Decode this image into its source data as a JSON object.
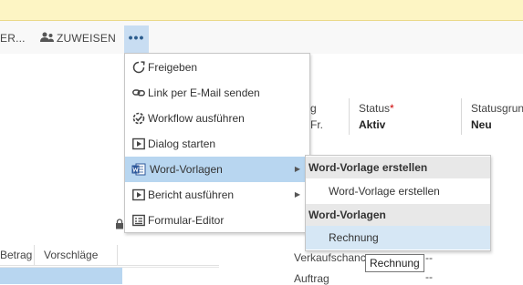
{
  "commandbar": {
    "truncated_item": "ER...",
    "assign_label": "ZUWEISEN",
    "more_label": "•••"
  },
  "header_fields": {
    "partial_label_g": "g",
    "partial_value_fr": "Fr.",
    "status_label": "Status",
    "status_required": "*",
    "status_value": "Aktiv",
    "statusgrund_label": "Statusgrun",
    "statusgrund_value": "Neu"
  },
  "grid": {
    "columns": [
      "Betrag",
      "Vorschläge"
    ]
  },
  "form_fields": {
    "verkaufschance_label": "Verkaufschanc",
    "verkaufschance_value": "--",
    "auftrag_label": "Auftrag",
    "auftrag_value": "--"
  },
  "menu": {
    "items": [
      {
        "label": "Freigeben",
        "icon": "share-icon"
      },
      {
        "label": "Link per E-Mail senden",
        "icon": "link-icon"
      },
      {
        "label": "Workflow ausführen",
        "icon": "workflow-icon"
      },
      {
        "label": "Dialog starten",
        "icon": "dialog-icon"
      },
      {
        "label": "Word-Vorlagen",
        "icon": "word-icon",
        "has_submenu": true,
        "active": true
      },
      {
        "label": "Bericht ausführen",
        "icon": "report-icon",
        "has_submenu": true
      },
      {
        "label": "Formular-Editor",
        "icon": "form-editor-icon"
      }
    ]
  },
  "submenu": {
    "section1_header": "Word-Vorlage erstellen",
    "section1_item": "Word-Vorlage erstellen",
    "section2_header": "Word-Vorlagen",
    "section2_item": "Rechnung"
  },
  "tooltip": "Rechnung"
}
